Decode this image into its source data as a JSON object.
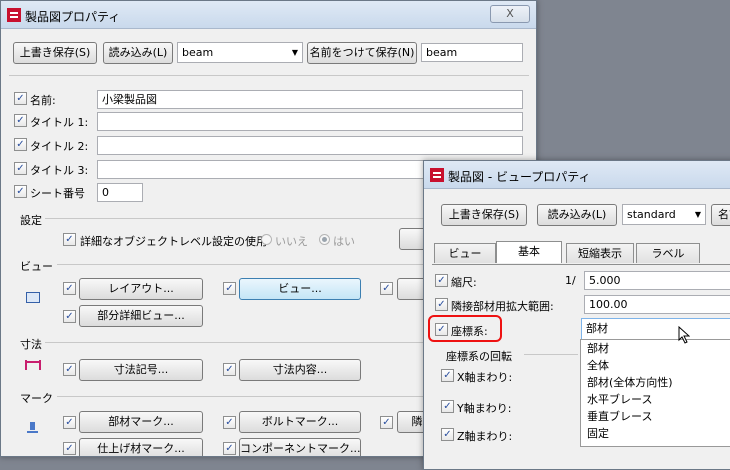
{
  "main_window": {
    "title": "製品図プロパティ",
    "close_label": "X",
    "toolbar": {
      "save_label": "上書き保存(S)",
      "load_label": "読み込み(L)",
      "preset_value": "beam",
      "save_as_label": "名前をつけて保存(N)",
      "save_as_value": "beam"
    },
    "fields": [
      {
        "label": "名前:",
        "value": "小梁製品図"
      },
      {
        "label": "タイトル 1:",
        "value": ""
      },
      {
        "label": "タイトル 2:",
        "value": ""
      },
      {
        "label": "タイトル 3:",
        "value": ""
      },
      {
        "label": "シート番号",
        "value": "0"
      }
    ],
    "settings": {
      "heading": "設定",
      "detailed_label": "詳細なオブジェクトレベル設定の使用",
      "option_no": "いいえ",
      "option_yes": "はい"
    },
    "view_section": {
      "heading": "ビュー",
      "layout_button": "レイアウト...",
      "view_button": "ビュー...",
      "detail_view_button": "部分詳細ビュー..."
    },
    "dimension_section": {
      "heading": "寸法",
      "dim_mark_button": "寸法記号...",
      "dim_content_button": "寸法内容..."
    },
    "mark_section": {
      "heading": "マーク",
      "part_mark_button": "部材マーク...",
      "bolt_mark_button": "ボルトマーク...",
      "partial_button": "隣",
      "finish_mark_button": "仕上げ材マーク...",
      "component_mark_button": "コンポーネントマーク..."
    }
  },
  "view_window": {
    "title": "製品図 - ビュープロパティ",
    "toolbar": {
      "save_label": "上書き保存(S)",
      "load_label": "読み込み(L)",
      "preset_value": "standard",
      "save_as_label": "名前"
    },
    "tabs": [
      "ビュー",
      "基本",
      "短縮表示",
      "ラベル"
    ],
    "active_tab": "基本",
    "scale": {
      "label": "縮尺:",
      "prefix": "1/",
      "value": "5.000"
    },
    "expand": {
      "label": "隣接部材用拡大範囲:",
      "value": "100.00"
    },
    "coord": {
      "label": "座標系:",
      "value": "部材",
      "options": [
        "部材",
        "全体",
        "部材(全体方向性)",
        "水平ブレース",
        "垂直ブレース",
        "固定"
      ]
    },
    "rotation": {
      "heading": "座標系の回転",
      "x_label": "X軸まわり:",
      "y_label": "Y軸まわり:",
      "z_label": "Z軸まわり:"
    }
  },
  "colors": {
    "highlight": "#e11111",
    "accent": "#3c7fb1"
  }
}
